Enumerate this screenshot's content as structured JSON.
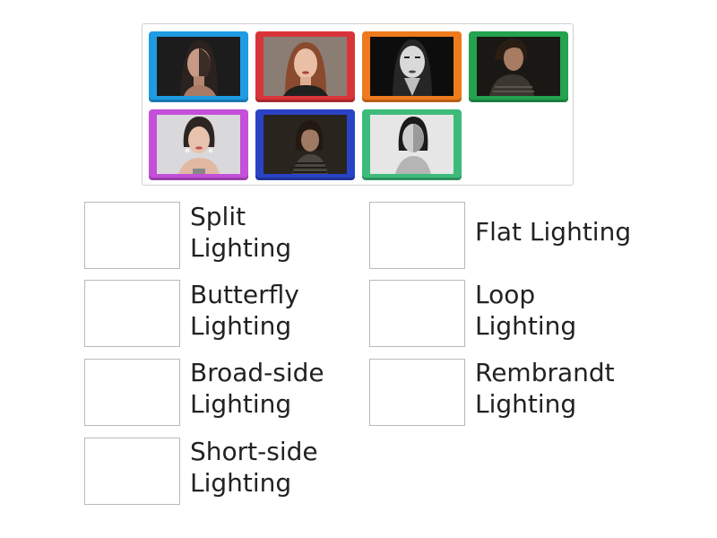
{
  "tiles": [
    {
      "id": 1,
      "color": "#1e9be3",
      "photo": "portrait-woman-dark-hair-split-light-icon"
    },
    {
      "id": 2,
      "color": "#d8343a",
      "photo": "portrait-woman-auburn-hair-flat-light-icon"
    },
    {
      "id": 3,
      "color": "#ee7a1c",
      "photo": "portrait-woman-bw-butterfly-light-icon"
    },
    {
      "id": 4,
      "color": "#23a24f",
      "photo": "portrait-person-short-hair-dark-icon"
    },
    {
      "id": 5,
      "color": "#c44fd9",
      "photo": "portrait-woman-earrings-light-icon"
    },
    {
      "id": 6,
      "color": "#2a43c6",
      "photo": "portrait-woman-bangs-dark-icon"
    },
    {
      "id": 7,
      "color": "#3dbb7a",
      "photo": "portrait-woman-bw-side-light-icon"
    }
  ],
  "targets": [
    {
      "label": "Split\nLighting"
    },
    {
      "label": "Flat Lighting"
    },
    {
      "label": "Butterfly\nLighting"
    },
    {
      "label": "Loop\nLighting"
    },
    {
      "label": "Broad-side\nLighting"
    },
    {
      "label": "Rembrandt\nLighting"
    },
    {
      "label": "Short-side\nLighting"
    }
  ]
}
